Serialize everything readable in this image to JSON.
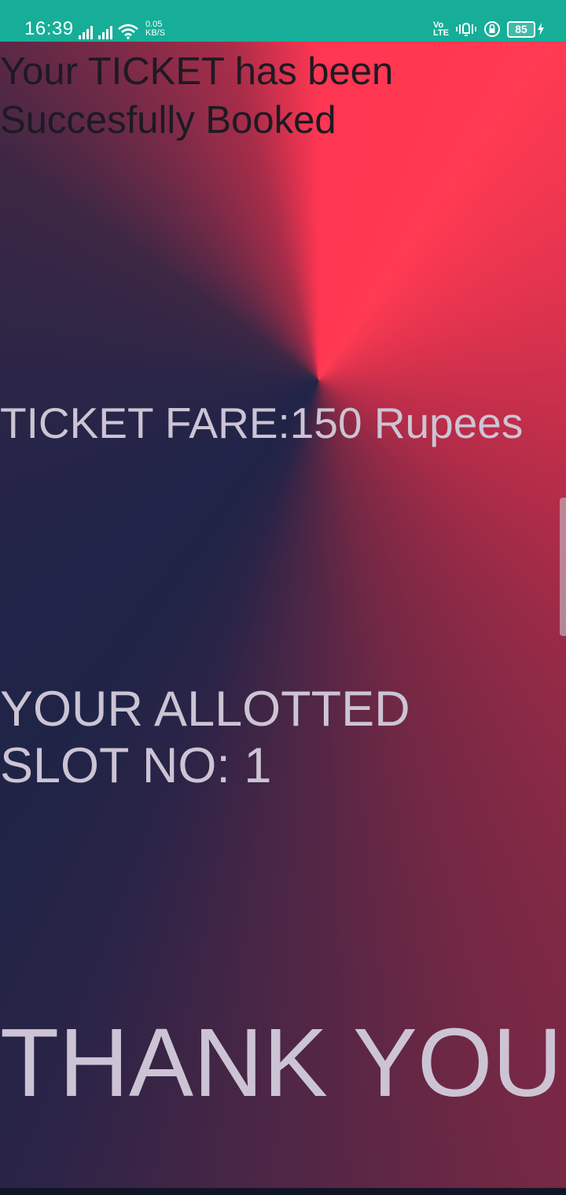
{
  "status_bar": {
    "time": "16:39",
    "net_speed_value": "0.05",
    "net_speed_unit": "KB/S",
    "volte_top": "Vo",
    "volte_bottom": "LTE",
    "battery_level": "85",
    "background_color": "#16ae98"
  },
  "ticket": {
    "headline": "Your TICKET has been Succesfully Booked",
    "fare": "TICKET FARE:150 Rupees",
    "slot": "YOUR ALLOTTED SLOT NO: 1",
    "thanks": "THANK YOU"
  },
  "colors": {
    "gradient_red": "#ff3652",
    "gradient_navy": "#1f2447",
    "headline_text": "#1d1a24",
    "body_text": "#ccc4d4"
  }
}
